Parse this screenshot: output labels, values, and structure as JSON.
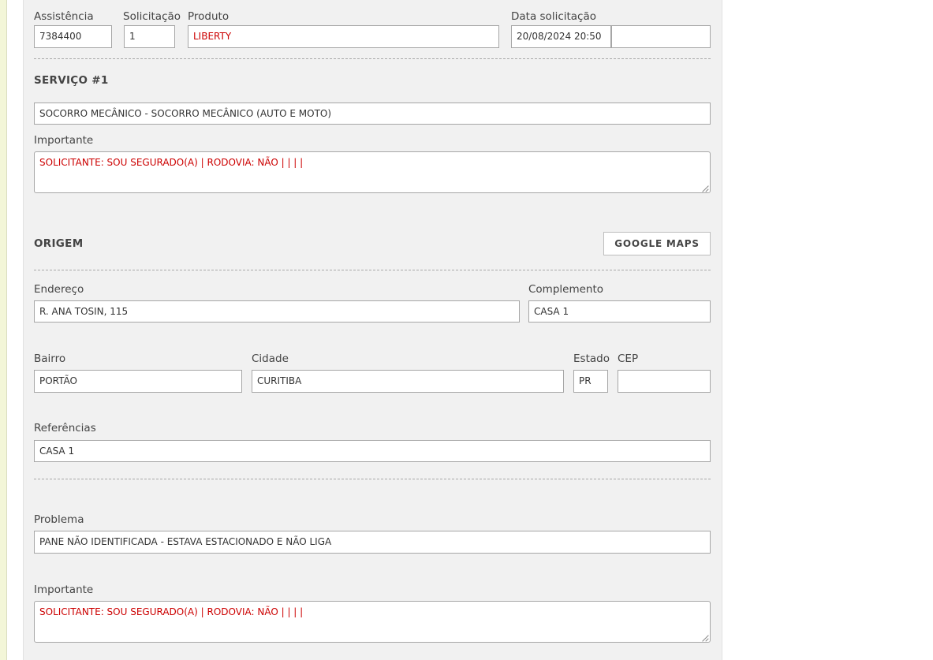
{
  "header": {
    "assistencia": {
      "label": "Assistência",
      "value": "7384400"
    },
    "solicitacao": {
      "label": "Solicitação",
      "value": "1"
    },
    "produto": {
      "label": "Produto",
      "value": "LIBERTY"
    },
    "data_solicitacao": {
      "label": "Data solicitação",
      "value": "20/08/2024 20:50",
      "extra_value": ""
    }
  },
  "servico": {
    "heading": "SERVIÇO #1",
    "value": "SOCORRO MECÂNICO - SOCORRO MECÂNICO (AUTO E MOTO)",
    "importante_label": "Importante",
    "importante_value": "SOLICITANTE: SOU SEGURADO(A) | RODOVIA: NÃO |  |   |   |"
  },
  "origem": {
    "heading": "ORIGEM",
    "maps_button": "GOOGLE MAPS",
    "endereco": {
      "label": "Endereço",
      "value": "R. ANA TOSIN, 115"
    },
    "complemento": {
      "label": "Complemento",
      "value": "CASA 1"
    },
    "bairro": {
      "label": "Bairro",
      "value": "PORTÃO"
    },
    "cidade": {
      "label": "Cidade",
      "value": "CURITIBA"
    },
    "estado": {
      "label": "Estado",
      "value": "PR"
    },
    "cep": {
      "label": "CEP",
      "value": ""
    },
    "referencias": {
      "label": "Referências",
      "value": "CASA 1"
    }
  },
  "problema": {
    "label": "Problema",
    "value": "PANE NÃO IDENTIFICADA - ESTAVA ESTACIONADO E NÃO LIGA",
    "importante_label": "Importante",
    "importante_value": "SOLICITANTE: SOU SEGURADO(A) | RODOVIA: NÃO |  |   |   |"
  },
  "colors": {
    "panel_bg": "#f1f1f1",
    "left_strip": "#f3f6d8",
    "highlight_text": "#cc0000"
  }
}
